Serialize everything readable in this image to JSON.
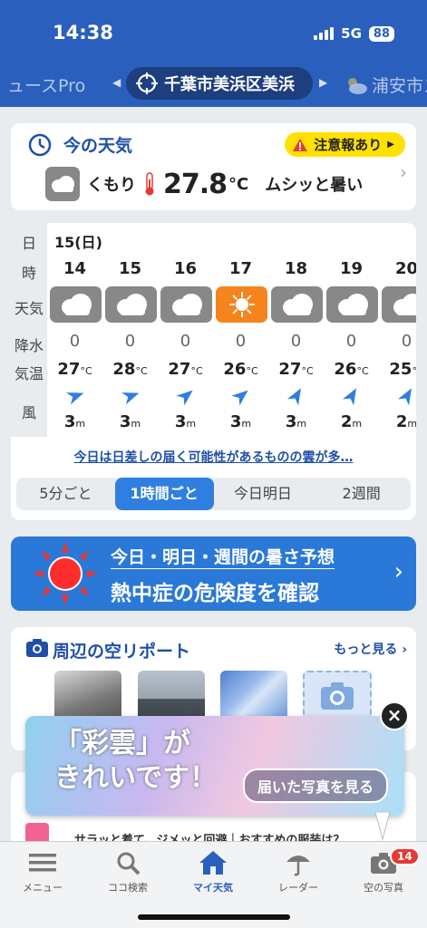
{
  "status_bar": {
    "time": "14:38",
    "network": "5G",
    "battery": "88"
  },
  "location_nav": {
    "prev_label": "ュースPro",
    "current_location": "千葉市美浜区美浜",
    "next_label": "浦安市ス"
  },
  "current_weather": {
    "title": "今の天気",
    "alert_label": "注意報あり",
    "condition": "くもり",
    "temperature": "27.8",
    "temp_unit": "°C",
    "feeling": "ムシッと暑い"
  },
  "forecast": {
    "row_labels": {
      "day": "日",
      "hour": "時",
      "weather": "天気",
      "rain": "降水",
      "temp": "気温",
      "wind": "風"
    },
    "date": "15(日)",
    "hours": [
      {
        "hour": "14",
        "weather": "cloudy",
        "rain": "0",
        "temp": "27",
        "wind_dir": 70,
        "wind_speed": "3"
      },
      {
        "hour": "15",
        "weather": "cloudy",
        "rain": "0",
        "temp": "28",
        "wind_dir": 70,
        "wind_speed": "3"
      },
      {
        "hour": "16",
        "weather": "cloudy",
        "rain": "0",
        "temp": "27",
        "wind_dir": 50,
        "wind_speed": "3"
      },
      {
        "hour": "17",
        "weather": "sunny",
        "rain": "0",
        "temp": "26",
        "wind_dir": 50,
        "wind_speed": "3"
      },
      {
        "hour": "18",
        "weather": "cloudy",
        "rain": "0",
        "temp": "27",
        "wind_dir": 30,
        "wind_speed": "3"
      },
      {
        "hour": "19",
        "weather": "cloudy",
        "rain": "0",
        "temp": "26",
        "wind_dir": 30,
        "wind_speed": "2"
      },
      {
        "hour": "20",
        "weather": "cloudy",
        "rain": "0",
        "temp": "25",
        "wind_dir": 30,
        "wind_speed": "2"
      }
    ],
    "temp_unit": "°C",
    "wind_unit": "m",
    "summary_link": "今日は日差しの届く可能性があるものの雲が多…",
    "tabs": [
      "5分ごと",
      "1時間ごと",
      "今日明日",
      "2週間"
    ],
    "active_tab": "1時間ごと"
  },
  "heat_banner": {
    "subtitle": "今日・明日・週間の暑さ予想",
    "title": "熱中症の危険度を確認"
  },
  "sky_report": {
    "title": "周辺の空リポート",
    "more_label": "もっと見る"
  },
  "ad": {
    "headline_line1": "「彩雲」が",
    "headline_line2": "きれいです！",
    "button_label": "届いた写真を見る"
  },
  "peek_card": {
    "text": "サラッと着て、ジメッと回避｜おすすめの服装は？"
  },
  "tab_bar": {
    "items": [
      {
        "label": "メニュー",
        "icon": "menu-icon"
      },
      {
        "label": "ココ検索",
        "icon": "search-icon"
      },
      {
        "label": "マイ天気",
        "icon": "home-icon"
      },
      {
        "label": "レーダー",
        "icon": "umbrella-icon"
      },
      {
        "label": "空の写真",
        "icon": "camera-icon"
      }
    ],
    "active": "マイ天気",
    "photo_badge": "14"
  },
  "colors": {
    "header_blue": "#2a5fbd",
    "active_tab": "#2f7fe0",
    "sunny_orange": "#f5841f",
    "alert_yellow": "#ffe100"
  }
}
